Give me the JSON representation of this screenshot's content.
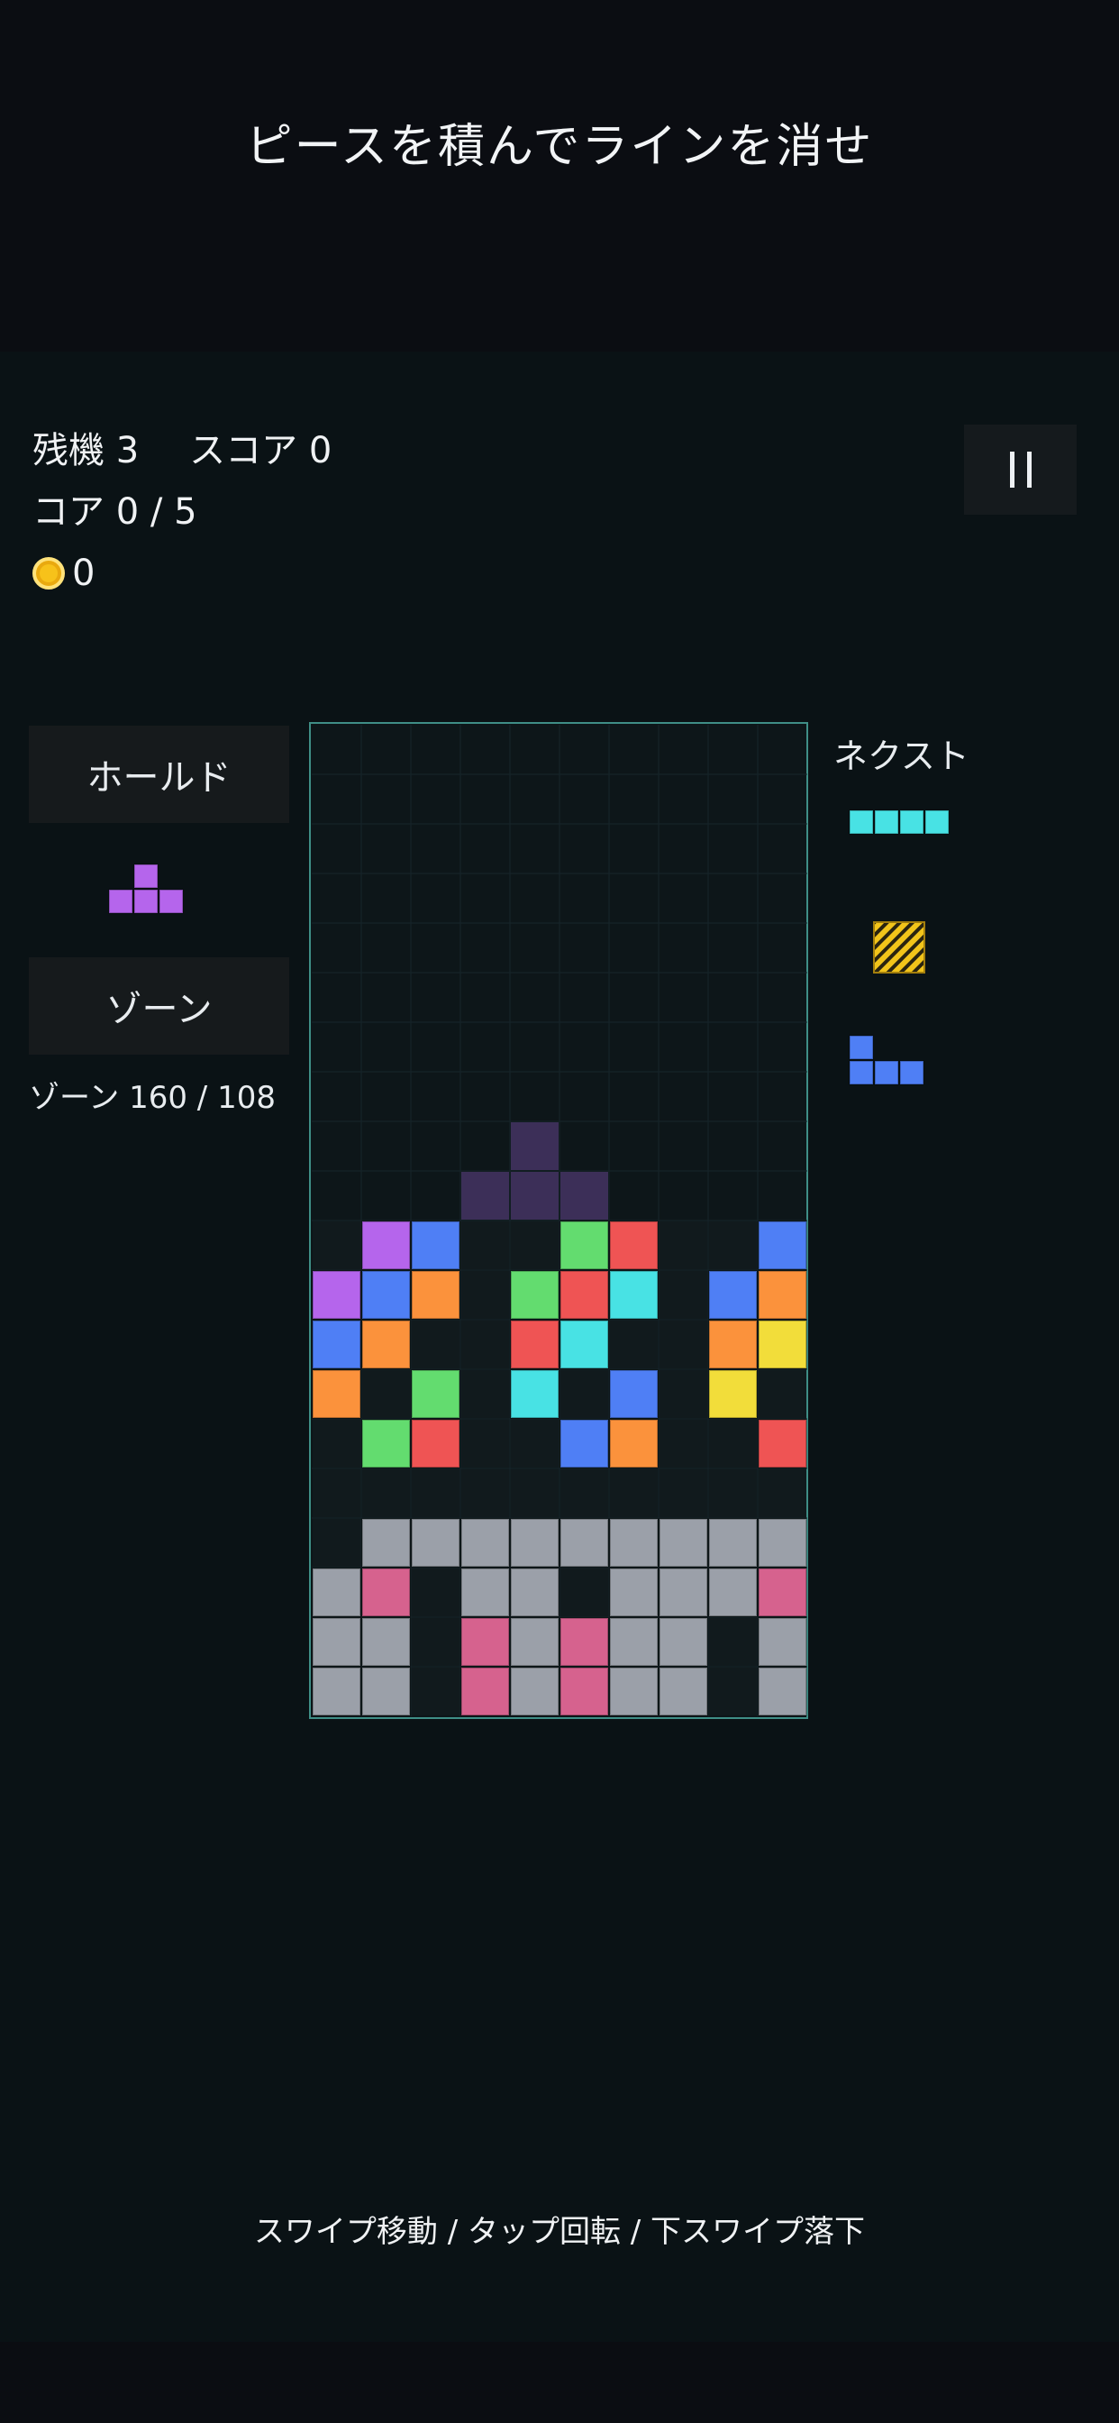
{
  "banner": "ピースを積んでラインを消せ",
  "stats": {
    "lives_label": "残機 3",
    "score_label": "スコア 0",
    "core_label": "コア 0 / 5",
    "coins": "0"
  },
  "buttons": {
    "hold": "ホールド",
    "zone": "ゾーン"
  },
  "zone_status": "ゾーン 160 / 108",
  "next_label": "ネクスト",
  "footer": "スワイプ移動 / タップ回転 / 下スワイプ落下",
  "colors": {
    "P": "#b565ec",
    "B": "#4f7ff5",
    "O": "#fb923c",
    "G": "#63dc6f",
    "R": "#ef5454",
    "C": "#48e2e4",
    "Y": "#f2dd3a",
    "K": "#d6628e",
    "S": "#9ba0a9",
    "D": "#3c2f58",
    "Z": "#111a1d"
  },
  "board": {
    "rows": [
      "..........",
      "..........",
      "..........",
      "..........",
      "..........",
      "..........",
      "..........",
      "..........",
      "....D.....",
      "...DDD....",
      "ZPBZZGRZZB",
      "PBOZGRCZBO",
      "BOZZRCZZOY",
      "OZGZCZBZYZ",
      "ZGRZZBOZZR",
      "ZZZZZZZZZZ",
      "ZSSSSSSSSS",
      "SKZSSZSSSK",
      "SSZKSKSSZS",
      "SSZKSKSSZS"
    ]
  },
  "hold_piece": {
    "type": "T",
    "color": "#b565ec"
  },
  "next_pieces": [
    {
      "type": "I",
      "color": "#48e2e4"
    },
    {
      "type": "special-hatched",
      "color": "#f2c41a"
    },
    {
      "type": "J",
      "color": "#4f7ff5"
    }
  ]
}
